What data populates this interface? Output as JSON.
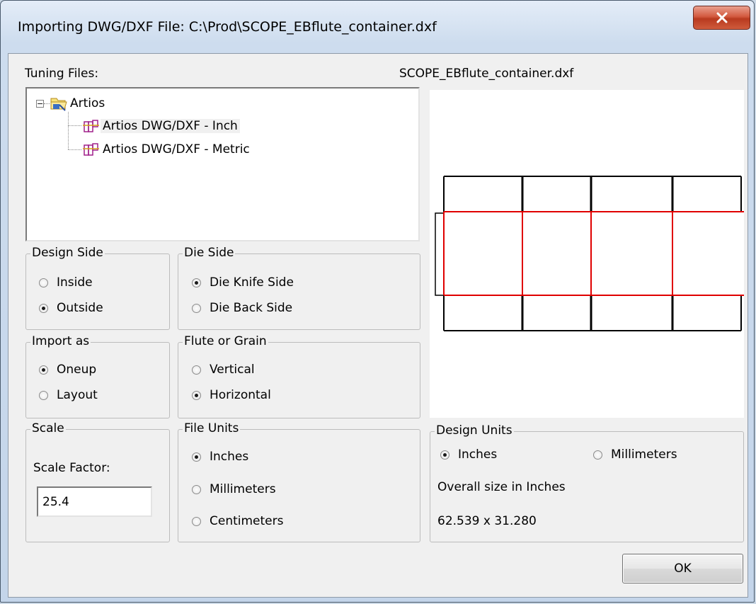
{
  "window": {
    "title": "Importing DWG/DXF File: C:\\Prod\\SCOPE_EBflute_container.dxf"
  },
  "tuning_files": {
    "label": "Tuning Files:",
    "tree": {
      "root": "Artios",
      "children": [
        "Artios DWG/DXF - Inch",
        "Artios DWG/DXF - Metric"
      ],
      "selected_index": 0
    }
  },
  "preview": {
    "filename": "SCOPE_EBflute_container.dxf"
  },
  "design_side": {
    "title": "Design Side",
    "options": [
      "Inside",
      "Outside"
    ],
    "selected": "Outside"
  },
  "die_side": {
    "title": "Die Side",
    "options": [
      "Die Knife Side",
      "Die Back Side"
    ],
    "selected": "Die Knife Side"
  },
  "import_as": {
    "title": "Import as",
    "options": [
      "Oneup",
      "Layout"
    ],
    "selected": "Oneup"
  },
  "flute_or_grain": {
    "title": "Flute or Grain",
    "options": [
      "Vertical",
      "Horizontal"
    ],
    "selected": "Horizontal"
  },
  "scale": {
    "title": "Scale",
    "factor_label": "Scale Factor:",
    "factor_value": "25.4"
  },
  "file_units": {
    "title": "File Units",
    "options": [
      "Inches",
      "Millimeters",
      "Centimeters"
    ],
    "selected": "Inches"
  },
  "design_units": {
    "title": "Design Units",
    "options": [
      "Inches",
      "Millimeters"
    ],
    "selected": "Inches",
    "overall_size_label": "Overall size in Inches",
    "overall_size_value": "62.539 x 31.280"
  },
  "buttons": {
    "ok": "OK",
    "close_icon": "close-x-icon"
  },
  "colors": {
    "accent_close": "#c9462c",
    "cut_line": "#000000",
    "crease_line": "#e00000"
  }
}
